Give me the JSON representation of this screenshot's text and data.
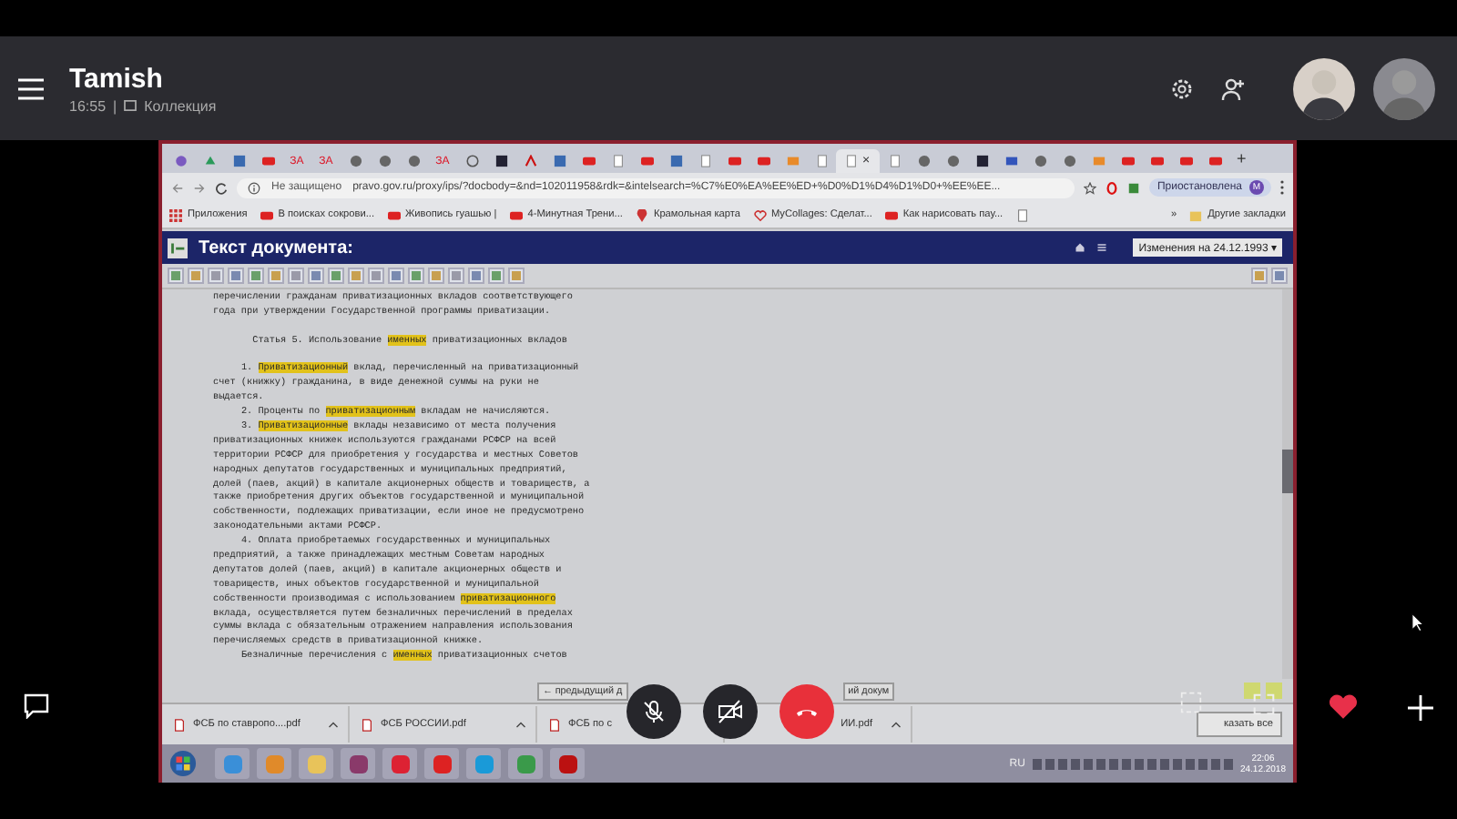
{
  "call": {
    "contact": "Tamish",
    "time": "16:55",
    "separator": "|",
    "collection": "Коллекция"
  },
  "browser": {
    "tabs": [
      {
        "kind": "app",
        "selected": false
      },
      {
        "kind": "drive",
        "selected": false
      },
      {
        "kind": "doc",
        "selected": false
      },
      {
        "kind": "video",
        "selected": false
      },
      {
        "kind": "text",
        "label": "ЗА",
        "selected": false
      },
      {
        "kind": "text",
        "label": "ЗА",
        "selected": false
      },
      {
        "kind": "globe",
        "selected": false
      },
      {
        "kind": "globe",
        "selected": false
      },
      {
        "kind": "globe",
        "selected": false
      },
      {
        "kind": "text",
        "label": "ЗА",
        "selected": false
      },
      {
        "kind": "clock",
        "selected": false
      },
      {
        "kind": "dark",
        "selected": false
      },
      {
        "kind": "pdf",
        "selected": false
      },
      {
        "kind": "doc",
        "selected": false
      },
      {
        "kind": "video",
        "selected": false
      },
      {
        "kind": "page",
        "selected": false
      },
      {
        "kind": "video",
        "selected": false
      },
      {
        "kind": "doc",
        "selected": false
      },
      {
        "kind": "page",
        "selected": false
      },
      {
        "kind": "video",
        "selected": false
      },
      {
        "kind": "video",
        "selected": false
      },
      {
        "kind": "mail",
        "selected": false
      },
      {
        "kind": "page",
        "selected": false
      },
      {
        "kind": "page",
        "selected": true,
        "close": "×"
      },
      {
        "kind": "page",
        "selected": false
      },
      {
        "kind": "globe",
        "selected": false
      },
      {
        "kind": "globe",
        "selected": false
      },
      {
        "kind": "dark",
        "selected": false
      },
      {
        "kind": "flag",
        "selected": false
      },
      {
        "kind": "globe",
        "selected": false
      },
      {
        "kind": "globe",
        "selected": false
      },
      {
        "kind": "mail",
        "selected": false
      },
      {
        "kind": "video",
        "selected": false
      },
      {
        "kind": "video",
        "selected": false
      },
      {
        "kind": "video",
        "selected": false
      },
      {
        "kind": "video",
        "selected": false
      }
    ],
    "new_tab": "+",
    "address": {
      "security": "Не защищено",
      "url": "pravo.gov.ru/proxy/ips/?docbody=&nd=102011958&rdk=&intelsearch=%C7%E0%EA%EE%ED+%D0%D1%D4%D1%D0+%EE%EE..."
    },
    "profile": {
      "status": "Приостановлена",
      "initial": "M"
    },
    "bookmarks": [
      {
        "kind": "apps",
        "label": "Приложения"
      },
      {
        "kind": "video",
        "label": "В поисках сокрови..."
      },
      {
        "kind": "video",
        "label": "Живопись гуашью |"
      },
      {
        "kind": "video",
        "label": "4-Минутная Трени..."
      },
      {
        "kind": "pin",
        "label": "Крамольная карта"
      },
      {
        "kind": "heart",
        "label": "MyCollages: Сделат..."
      },
      {
        "kind": "video",
        "label": "Как нарисовать пау..."
      },
      {
        "kind": "page"
      }
    ],
    "more": "»",
    "other_bookmarks": "Другие закладки"
  },
  "document": {
    "title": "Текст документа:",
    "version": "Изменения на 24.12.1993 ▾",
    "lines": [
      {
        "kind": "line",
        "parts": [
          {
            "text": "перечислении гражданам приватизационных вкладов соответствующего",
            "highlighted": false
          }
        ]
      },
      {
        "kind": "line",
        "parts": [
          {
            "text": "года при утверждении Государственной программы приватизации.",
            "highlighted": false
          }
        ]
      },
      {
        "kind": "blank"
      },
      {
        "kind": "heading",
        "parts": [
          {
            "text": "Статья 5. Использование ",
            "highlighted": false
          },
          {
            "text": "именных",
            "highlighted": true
          },
          {
            "text": " приватизационных вкладов",
            "highlighted": false
          }
        ]
      },
      {
        "kind": "blank"
      },
      {
        "kind": "first",
        "parts": [
          {
            "text": "1. ",
            "highlighted": false
          },
          {
            "text": "Приватизационный",
            "highlighted": true
          },
          {
            "text": " вклад, перечисленный на приватизационный",
            "highlighted": false
          }
        ]
      },
      {
        "kind": "line",
        "parts": [
          {
            "text": "счет (книжку) гражданина, в виде денежной суммы на руки не",
            "highlighted": false
          }
        ]
      },
      {
        "kind": "line",
        "parts": [
          {
            "text": "выдается.",
            "highlighted": false
          }
        ]
      },
      {
        "kind": "first",
        "parts": [
          {
            "text": "2. Проценты по ",
            "highlighted": false
          },
          {
            "text": "приватизационным",
            "highlighted": true
          },
          {
            "text": " вкладам не начисляются.",
            "highlighted": false
          }
        ]
      },
      {
        "kind": "first",
        "parts": [
          {
            "text": "3. ",
            "highlighted": false
          },
          {
            "text": "Приватизационные",
            "highlighted": true
          },
          {
            "text": " вклады независимо от места получения",
            "highlighted": false
          }
        ]
      },
      {
        "kind": "line",
        "parts": [
          {
            "text": "приватизационных книжек используются гражданами РСФСР на всей",
            "highlighted": false
          }
        ]
      },
      {
        "kind": "line",
        "parts": [
          {
            "text": "территории РСФСР для приобретения у государства и местных Советов",
            "highlighted": false
          }
        ]
      },
      {
        "kind": "line",
        "parts": [
          {
            "text": "народных депутатов государственных и муниципальных предприятий,",
            "highlighted": false
          }
        ]
      },
      {
        "kind": "line",
        "parts": [
          {
            "text": "долей (паев, акций) в капитале акционерных обществ и товариществ, а",
            "highlighted": false
          }
        ]
      },
      {
        "kind": "line",
        "parts": [
          {
            "text": "также приобретения других объектов государственной и муниципальной",
            "highlighted": false
          }
        ]
      },
      {
        "kind": "line",
        "parts": [
          {
            "text": "собственности, подлежащих приватизации, если иное не предусмотрено",
            "highlighted": false
          }
        ]
      },
      {
        "kind": "line",
        "parts": [
          {
            "text": "законодательными актами РСФСР.",
            "highlighted": false
          }
        ]
      },
      {
        "kind": "first",
        "parts": [
          {
            "text": "4. Оплата приобретаемых государственных и муниципальных",
            "highlighted": false
          }
        ]
      },
      {
        "kind": "line",
        "parts": [
          {
            "text": "предприятий, а также принадлежащих местным Советам народных",
            "highlighted": false
          }
        ]
      },
      {
        "kind": "line",
        "parts": [
          {
            "text": "депутатов долей (паев, акций) в капитале акционерных обществ и",
            "highlighted": false
          }
        ]
      },
      {
        "kind": "line",
        "parts": [
          {
            "text": "товариществ, иных объектов государственной и муниципальной",
            "highlighted": false
          }
        ]
      },
      {
        "kind": "line",
        "parts": [
          {
            "text": "собственности производимая с использованием ",
            "highlighted": false
          },
          {
            "text": "приватизационного",
            "highlighted": true
          }
        ]
      },
      {
        "kind": "line",
        "parts": [
          {
            "text": "вклада, осуществляется путем безналичных перечислений в пределах",
            "highlighted": false
          }
        ]
      },
      {
        "kind": "line",
        "parts": [
          {
            "text": "суммы вклада с обязательным отражением направления использования",
            "highlighted": false
          }
        ]
      },
      {
        "kind": "line",
        "parts": [
          {
            "text": "перечисляемых средств в приватизационной книжке.",
            "highlighted": false
          }
        ]
      },
      {
        "kind": "first",
        "parts": [
          {
            "text": "Безналичные перечисления с ",
            "highlighted": false
          },
          {
            "text": "именных",
            "highlighted": true
          },
          {
            "text": " приватизационных счетов",
            "highlighted": false
          }
        ]
      }
    ],
    "nav": [
      "← предыдущий д",
      "ий докум"
    ]
  },
  "downloads": {
    "files": [
      {
        "label": "ФСБ по ставропо....pdf",
        "icon": true,
        "caret": true
      },
      {
        "label": "ФСБ РОССИИ.pdf",
        "icon": true,
        "caret": true
      },
      {
        "label": "ФСБ по с",
        "icon": true,
        "caret": false
      },
      {
        "label": "ИИ.pdf",
        "icon": false,
        "caret": true
      }
    ],
    "show_all": "казать все"
  },
  "taskbar": {
    "language": "RU",
    "time": "22:06",
    "date": "24.12.2018"
  }
}
